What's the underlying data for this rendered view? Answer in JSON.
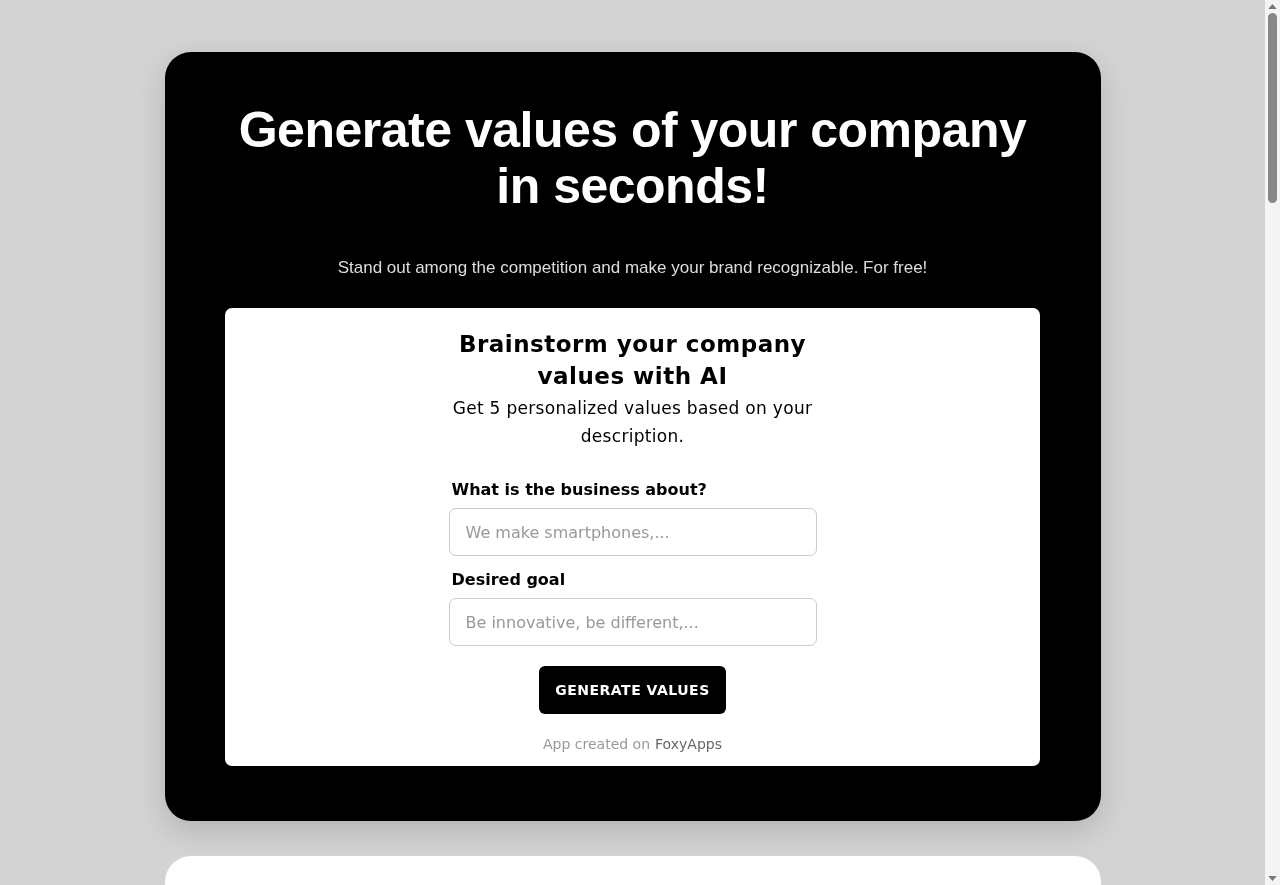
{
  "hero": {
    "title": "Generate values of your company in seconds!",
    "subtitle": "Stand out among the competition and make your brand recognizable. For free!"
  },
  "form": {
    "title": "Brainstorm your company values with AI",
    "description": "Get 5 personalized values based on your description.",
    "fields": [
      {
        "label": "What is the business about?",
        "placeholder": "We make smartphones,..."
      },
      {
        "label": "Desired goal",
        "placeholder": "Be innovative, be different,..."
      }
    ],
    "button": "GENERATE VALUES",
    "footer_text": "App created on",
    "footer_link": "FoxyApps"
  }
}
